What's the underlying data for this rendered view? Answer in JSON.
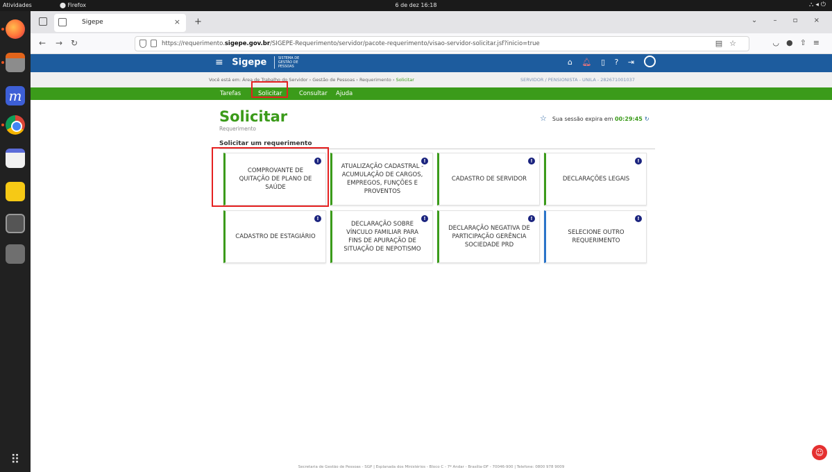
{
  "os": {
    "activities": "Atividades",
    "app_name": "Firefox",
    "clock": "6 de dez  16:18"
  },
  "browser": {
    "tab_title": "Sigepe",
    "url_prefix": "https://requerimento.",
    "url_domain": "sigepe.gov.br",
    "url_path": "/SIGEPE-Requerimento/servidor/pacote-requerimento/visao-servidor-solicitar.jsf?inicio=true"
  },
  "header": {
    "brand": "Sigepe",
    "brand_sub": "SISTEMA DE GESTÃO DE PESSOAS"
  },
  "breadcrumb": {
    "prefix": "Você está em:",
    "path": "Área de Trabalho do Servidor › Gestão de Pessoas › Requerimento ›",
    "current": "Solicitar",
    "role": "SERVIDOR / PENSIONISTA - UNILA - 282671001037"
  },
  "menu": {
    "items": [
      "Tarefas",
      "Solicitar",
      "Consultar",
      "Ajuda"
    ]
  },
  "page": {
    "title": "Solicitar",
    "subtitle": "Requerimento",
    "session_label": "Sua sessão expira em",
    "session_time": "00:29:45",
    "section_title": "Solicitar um requerimento"
  },
  "cards": [
    "COMPROVANTE DE QUITAÇÃO DE PLANO DE SAÚDE",
    "ATUALIZAÇÃO CADASTRAL - ACUMULAÇÃO DE CARGOS, EMPREGOS, FUNÇÕES E PROVENTOS",
    "CADASTRO DE SERVIDOR",
    "DECLARAÇÕES LEGAIS",
    "CADASTRO DE ESTAGIÁRIO",
    "DECLARAÇÃO SOBRE VÍNCULO FAMILIAR PARA FINS DE APURAÇÃO DE SITUAÇÃO DE NEPOTISMO",
    "DECLARAÇÃO NEGATIVA DE PARTICIPAÇÃO GERÊNCIA SOCIEDADE PRD",
    "SELECIONE OUTRO REQUERIMENTO"
  ],
  "footer": "Secretaria de Gestão de Pessoas - SGP | Esplanada dos Ministérios - Bloco C - 7º Andar - Brasília-DF - 70046-900 | Telefone: 0800 978 9009",
  "colors": {
    "header_blue": "#1d5c9e",
    "menu_green": "#3b9b1a",
    "highlight_red": "#e52020"
  }
}
